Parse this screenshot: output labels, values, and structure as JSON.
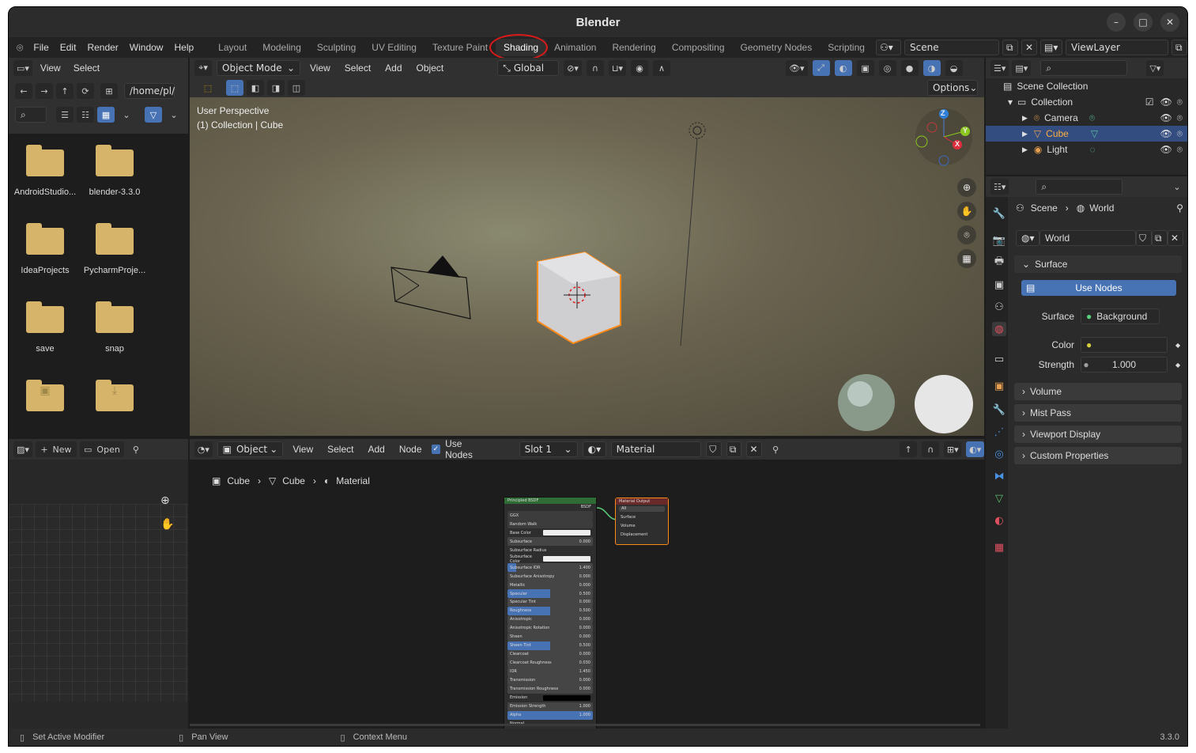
{
  "window": {
    "title": "Blender",
    "minimize": "–",
    "maximize": "□",
    "close": "✕"
  },
  "menu": {
    "file": "File",
    "edit": "Edit",
    "render": "Render",
    "window": "Window",
    "help": "Help"
  },
  "workspaces": [
    "Layout",
    "Modeling",
    "Sculpting",
    "UV Editing",
    "Texture Paint",
    "Shading",
    "Animation",
    "Rendering",
    "Compositing",
    "Geometry Nodes",
    "Scripting"
  ],
  "workspace_add": "+",
  "scene": {
    "name": "Scene",
    "view_layer": "ViewLayer"
  },
  "file_browser": {
    "view": "View",
    "select": "Select",
    "path": "/home/pl/",
    "folders": [
      {
        "label": "AndroidStudio..."
      },
      {
        "label": "blender-3.3.0"
      },
      {
        "label": "IdeaProjects"
      },
      {
        "label": "PycharmProje..."
      },
      {
        "label": "save"
      },
      {
        "label": "snap"
      }
    ]
  },
  "viewport": {
    "mode": "Object Mode",
    "view": "View",
    "select": "Select",
    "add": "Add",
    "object": "Object",
    "transform": "Global",
    "options": "Options",
    "perspective": "User Perspective",
    "collection": "(1) Collection | Cube",
    "gizmo": {
      "z": "Z",
      "y": "Y",
      "x": "X"
    }
  },
  "outliner": {
    "scene_collection": "Scene Collection",
    "items": [
      {
        "label": "Collection"
      },
      {
        "label": "Camera"
      },
      {
        "label": "Cube"
      },
      {
        "label": "Light"
      }
    ]
  },
  "properties": {
    "breadcrumb_scene": "Scene",
    "breadcrumb_world": "World",
    "world_name": "World",
    "surface_section": "Surface",
    "use_nodes": "Use Nodes",
    "surface_label": "Surface",
    "surface_value": "Background",
    "color_label": "Color",
    "strength_label": "Strength",
    "strength_value": "1.000",
    "sections": [
      "Volume",
      "Mist Pass",
      "Viewport Display",
      "Custom Properties"
    ]
  },
  "image_editor": {
    "new": "New",
    "open": "Open"
  },
  "node_editor": {
    "object": "Object",
    "view": "View",
    "select": "Select",
    "add": "Add",
    "node": "Node",
    "use_nodes": "Use Nodes",
    "slot": "Slot 1",
    "material": "Material",
    "breadcrumb": [
      "Cube",
      "Cube",
      "Material"
    ],
    "bsdf_title": "Principled BSDF",
    "bsdf_out": "BSDF",
    "bsdf_rows": [
      {
        "label": "GGX",
        "value": ""
      },
      {
        "label": "Random Walk",
        "value": ""
      },
      {
        "label": "Base Color",
        "value": ""
      },
      {
        "label": "Subsurface",
        "value": "0.000"
      },
      {
        "label": "Subsurface Radius",
        "value": ""
      },
      {
        "label": "Subsurface Color",
        "value": ""
      },
      {
        "label": "Subsurface IOR",
        "value": "1.400"
      },
      {
        "label": "Subsurface Anisotropy",
        "value": "0.000"
      },
      {
        "label": "Metallic",
        "value": "0.000"
      },
      {
        "label": "Specular",
        "value": "0.500"
      },
      {
        "label": "Specular Tint",
        "value": "0.000"
      },
      {
        "label": "Roughness",
        "value": "0.500"
      },
      {
        "label": "Anisotropic",
        "value": "0.000"
      },
      {
        "label": "Anisotropic Rotation",
        "value": "0.000"
      },
      {
        "label": "Sheen",
        "value": "0.000"
      },
      {
        "label": "Sheen Tint",
        "value": "0.500"
      },
      {
        "label": "Clearcoat",
        "value": "0.000"
      },
      {
        "label": "Clearcoat Roughness",
        "value": "0.030"
      },
      {
        "label": "IOR",
        "value": "1.450"
      },
      {
        "label": "Transmission",
        "value": "0.000"
      },
      {
        "label": "Transmission Roughness",
        "value": "0.000"
      },
      {
        "label": "Emission",
        "value": ""
      },
      {
        "label": "Emission Strength",
        "value": "1.000"
      },
      {
        "label": "Alpha",
        "value": "1.000"
      },
      {
        "label": "Normal",
        "value": ""
      }
    ],
    "output_title": "Material Output",
    "output_target": "All",
    "output_rows": [
      "Surface",
      "Volume",
      "Displacement"
    ]
  },
  "status": {
    "left": "Set Active Modifier",
    "middle": "Pan View",
    "right": "Context Menu",
    "version": "3.3.0"
  }
}
